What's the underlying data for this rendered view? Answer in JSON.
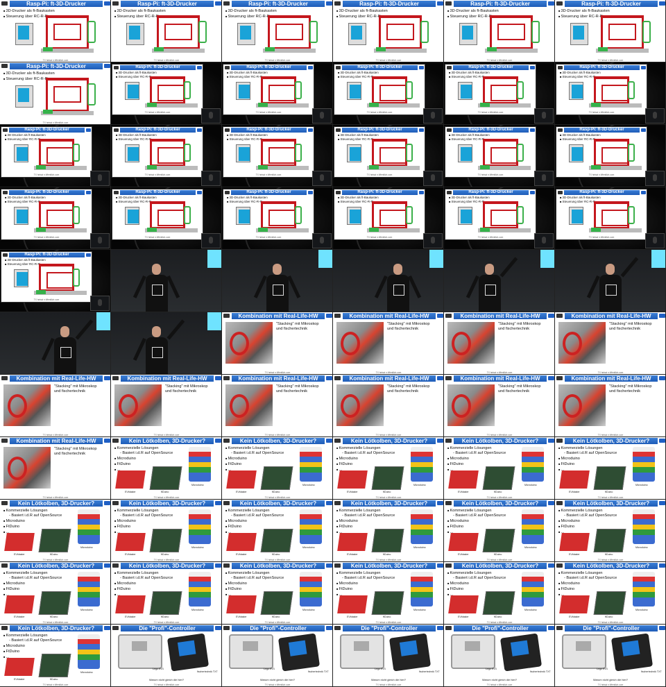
{
  "slides": {
    "rasp": {
      "title": "Rasp-Pi: ft-3D-Drucker",
      "bullets": [
        "3D-Drucker als ft-Baukasten",
        "Steuerung über RC-R-Pi"
      ],
      "footer": "TX heisst n öffentlich.com"
    },
    "reallife": {
      "title": "Kombination mit Real-Life-HW",
      "bullets": [
        "\"Stacking\" mit Mikroskop und fischertechnik"
      ],
      "footer": "TX heisst n öffentlich.com"
    },
    "loet": {
      "title": "Kein Lötkolben, 3D-Drucker?",
      "bullets": [
        "Kommerzielle Lösungen",
        "Basiert i.d.R auf OpenSource",
        "Microduino",
        "FtDuino",
        "..."
      ],
      "captions": [
        "EVblaster",
        "ftDuino",
        "Microduino"
      ],
      "footer": "TX heisst n öffentlich.com"
    },
    "profi": {
      "title": "Die \"Profi\"-Controller",
      "captions": [
        "Lego EV3",
        "fischertechnik TXT"
      ],
      "question": "Warum nicht gleich die hier?",
      "footer": "TX heisst n öffentlich.com"
    }
  },
  "tiles": [
    "rasp",
    "rasp",
    "rasp",
    "rasp",
    "rasp",
    "rasp",
    "rasp",
    "rasp-small",
    "rasp-small",
    "rasp-small",
    "rasp-small",
    "rasp-small",
    "rasp-small",
    "rasp-small",
    "rasp-small",
    "rasp-small",
    "rasp-small",
    "rasp-small",
    "rasp-small",
    "rasp-small",
    "rasp-small",
    "rasp-small",
    "rasp-small",
    "rasp-small",
    "rasp-small",
    "speaker",
    "speaker",
    "speaker",
    "speaker",
    "speaker",
    "speaker",
    "speaker",
    "reallife",
    "reallife",
    "reallife",
    "reallife",
    "reallife",
    "reallife",
    "reallife",
    "reallife",
    "reallife",
    "reallife",
    "reallife",
    "loet",
    "loet",
    "loet",
    "loet",
    "loet",
    "loet",
    "loet",
    "loet",
    "loet",
    "loet",
    "loet",
    "loet",
    "loet",
    "loet",
    "loet",
    "loet",
    "loet",
    "loet",
    "profi",
    "profi",
    "profi",
    "profi",
    "profi"
  ]
}
